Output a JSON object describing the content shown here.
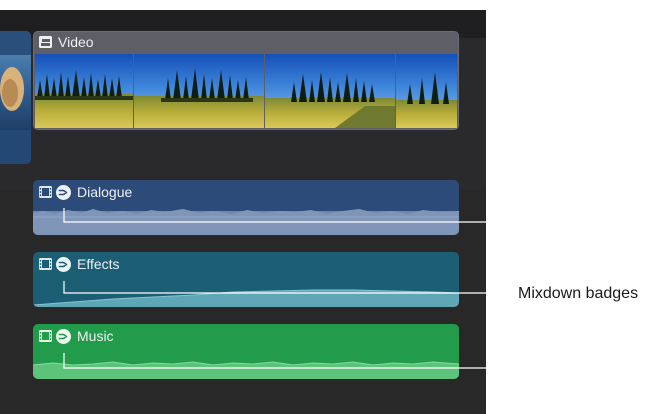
{
  "primary_clip": {
    "name": "Video"
  },
  "audio_lanes": [
    {
      "name": "Dialogue",
      "color": "#2c4b79"
    },
    {
      "name": "Effects",
      "color": "#1c5f74"
    },
    {
      "name": "Music",
      "color": "#229c4a"
    }
  ],
  "callout": {
    "label": "Mixdown badges"
  },
  "icons": {
    "video_clip": "connected-clip-icon",
    "audio_lane": "film-strip-icon",
    "badge": "mixdown-badge-icon"
  }
}
